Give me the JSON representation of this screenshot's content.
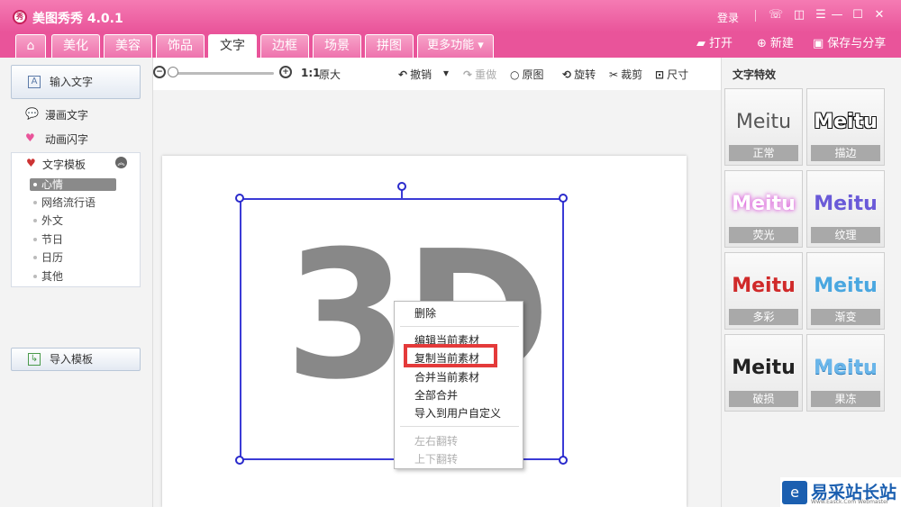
{
  "app": {
    "logo_text": "秀",
    "title": "美图秀秀 4.0.1"
  },
  "titlebar": {
    "login": "登录",
    "icons": {
      "message": "☏",
      "skin": "◫",
      "menu": "☰",
      "minimize": "—",
      "maximize": "☐",
      "close": "✕"
    }
  },
  "tabs": [
    {
      "label": "⌂"
    },
    {
      "label": "美化"
    },
    {
      "label": "美容"
    },
    {
      "label": "饰品"
    },
    {
      "label": "文字"
    },
    {
      "label": "边框"
    },
    {
      "label": "场景"
    },
    {
      "label": "拼图"
    },
    {
      "label": "更多功能 ▾"
    }
  ],
  "top_actions": {
    "open": "打开",
    "new": "新建",
    "save_share": "保存与分享"
  },
  "left": {
    "input_text": "输入文字",
    "comic_text": "漫画文字",
    "animated_text": "动画闪字",
    "template_header": "文字模板",
    "templates": [
      "心情",
      "网络流行语",
      "外文",
      "节日",
      "日历",
      "其他"
    ],
    "import_template": "导入模板"
  },
  "toolbar": {
    "ratio": "1:1",
    "original_size": "原大",
    "undo": "撤销",
    "redo": "重做",
    "original": "原图",
    "rotate": "旋转",
    "crop": "裁剪",
    "size": "尺寸"
  },
  "canvas": {
    "text": "3D"
  },
  "context_menu": {
    "delete": "删除",
    "edit": "编辑当前素材",
    "copy": "复制当前素材",
    "merge": "合并当前素材",
    "merge_all": "全部合并",
    "import_custom": "导入到用户自定义",
    "flip_h": "左右翻转",
    "flip_v": "上下翻转"
  },
  "right": {
    "title": "文字特效",
    "effects": [
      {
        "sample": "Meitu",
        "label": "正常"
      },
      {
        "sample": "Meitu",
        "label": "描边"
      },
      {
        "sample": "Meitu",
        "label": "荧光"
      },
      {
        "sample": "Meitu",
        "label": "纹理"
      },
      {
        "sample": "Meitu",
        "label": "多彩"
      },
      {
        "sample": "Meitu",
        "label": "渐变"
      },
      {
        "sample": "Meitu",
        "label": "破损"
      },
      {
        "sample": "Meitu",
        "label": "果冻"
      }
    ]
  },
  "watermark": {
    "text": "易采站长站",
    "sub": "Www.Easck.Com Webmaster"
  },
  "colors": {
    "brand_pink": "#e9549a",
    "selection_blue": "#3b3bd6",
    "highlight_red": "#e43a3a"
  }
}
